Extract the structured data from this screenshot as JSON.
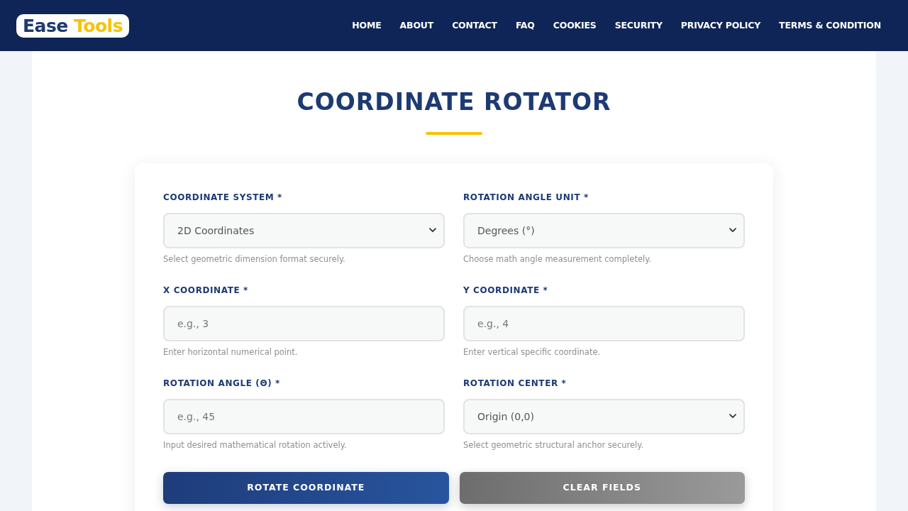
{
  "navbar": {
    "logo": {
      "primary": "Ease",
      "accent": "Tools"
    },
    "links": [
      "HOME",
      "ABOUT",
      "CONTACT",
      "FAQ",
      "COOKIES",
      "SECURITY",
      "PRIVACY POLICY",
      "TERMS & CONDITION"
    ]
  },
  "page": {
    "title": "COORDINATE ROTATOR"
  },
  "form": {
    "fields": [
      {
        "kind": "select",
        "label": "COORDINATE SYSTEM *",
        "value": "2D Coordinates",
        "help": "Select geometric dimension format securely."
      },
      {
        "kind": "select",
        "label": "ROTATION ANGLE UNIT *",
        "value": "Degrees (°)",
        "help": "Choose math angle measurement completely."
      },
      {
        "kind": "input",
        "label": "X COORDINATE *",
        "placeholder": "e.g., 3",
        "help": "Enter horizontal numerical point."
      },
      {
        "kind": "input",
        "label": "Y COORDINATE *",
        "placeholder": "e.g., 4",
        "help": "Enter vertical specific coordinate."
      },
      {
        "kind": "input",
        "label": "ROTATION ANGLE (Θ) *",
        "placeholder": "e.g., 45",
        "help": "Input desired mathematical rotation actively."
      },
      {
        "kind": "select",
        "label": "ROTATION CENTER *",
        "value": "Origin (0,0)",
        "help": "Select geometric structural anchor securely."
      }
    ],
    "buttons": [
      {
        "kind": "primary",
        "label": "ROTATE COORDINATE"
      },
      {
        "kind": "secondary",
        "label": "CLEAR FIELDS"
      }
    ]
  }
}
